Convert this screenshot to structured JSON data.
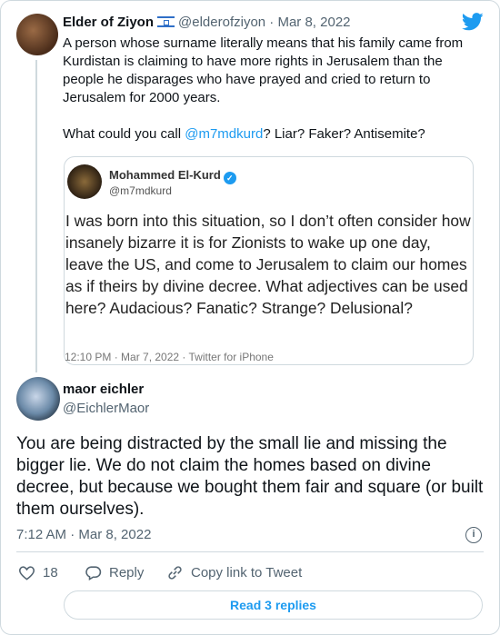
{
  "tweet": {
    "author_name": "Elder of Ziyon",
    "flag_icon": "israel-flag-icon",
    "handle": "@elderofziyon",
    "date": "· Mar 8, 2022",
    "text_lines": [
      "A person whose surname literally means that his family came from Kurdistan is claiming to have more rights in Jerusalem than the people he disparages who have prayed and cried to return to Jerusalem for 2000 years."
    ],
    "text_p1": "A person whose surname literally means that his family came from Kurdistan is claiming to have more rights in Jerusalem than the people he disparages who have prayed and cried to return to Jerusalem for 2000 years.",
    "text_p2_before": "What could you call ",
    "mention": "@m7mdkurd",
    "text_p2_after": "? Liar? Faker? Antisemite?"
  },
  "quoted": {
    "author_name": "Mohammed El-Kurd",
    "handle": "@m7mdkurd",
    "text": "I was born into this situation, so I don’t often consider how insanely bizarre it is for Zionists to wake up one day, leave the US, and come to Jerusalem to claim our homes as if theirs by divine decree. What adjectives can be used here? Audacious? Fanatic? Strange? Delusional?",
    "meta": "12:10 PM · Mar 7, 2022 · Twitter for iPhone"
  },
  "reply": {
    "author_name": "maor eichler",
    "handle": "@EichlerMaor",
    "text": "You are being distracted by the small lie and missing the bigger lie. We do not claim the homes based on divine decree, but because we bought them fair and square (or built them ourselves).",
    "time": "7:12 AM · Mar 8, 2022",
    "likes": "18",
    "reply_label": "Reply",
    "copy_label": "Copy link to Tweet",
    "read_replies": "Read 3 replies"
  },
  "colors": {
    "accent": "#1d9bf0",
    "text": "#0f1419",
    "muted": "#536471"
  }
}
